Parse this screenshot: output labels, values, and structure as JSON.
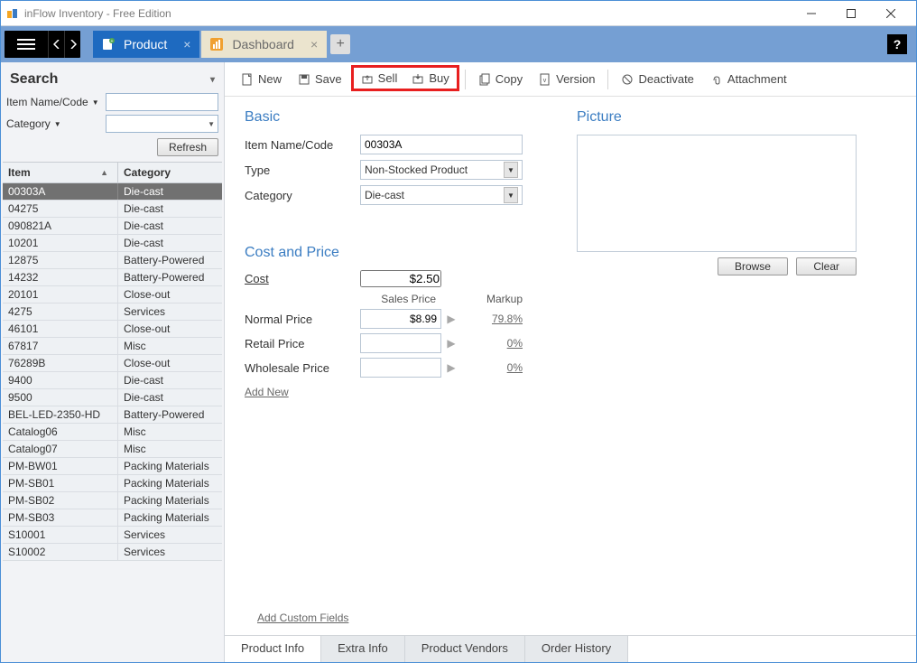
{
  "window": {
    "title": "inFlow Inventory - Free Edition"
  },
  "tabs": {
    "product": "Product",
    "dashboard": "Dashboard"
  },
  "toolbar": {
    "new": "New",
    "save": "Save",
    "sell": "Sell",
    "buy": "Buy",
    "copy": "Copy",
    "version": "Version",
    "deactivate": "Deactivate",
    "attachment": "Attachment"
  },
  "search": {
    "title": "Search",
    "itemname_label": "Item Name/Code",
    "category_label": "Category",
    "refresh": "Refresh"
  },
  "listhead": {
    "item": "Item",
    "category": "Category"
  },
  "items": [
    {
      "code": "00303A",
      "cat": "Die-cast"
    },
    {
      "code": "04275",
      "cat": "Die-cast"
    },
    {
      "code": "090821A",
      "cat": "Die-cast"
    },
    {
      "code": "10201",
      "cat": "Die-cast"
    },
    {
      "code": "12875",
      "cat": "Battery-Powered"
    },
    {
      "code": "14232",
      "cat": "Battery-Powered"
    },
    {
      "code": "20101",
      "cat": "Close-out"
    },
    {
      "code": "4275",
      "cat": "Services"
    },
    {
      "code": "46101",
      "cat": "Close-out"
    },
    {
      "code": "67817",
      "cat": "Misc"
    },
    {
      "code": "76289B",
      "cat": "Close-out"
    },
    {
      "code": "9400",
      "cat": "Die-cast"
    },
    {
      "code": "9500",
      "cat": "Die-cast"
    },
    {
      "code": "BEL-LED-2350-HD",
      "cat": "Battery-Powered"
    },
    {
      "code": "Catalog06",
      "cat": "Misc"
    },
    {
      "code": "Catalog07",
      "cat": "Misc"
    },
    {
      "code": "PM-BW01",
      "cat": "Packing Materials"
    },
    {
      "code": "PM-SB01",
      "cat": "Packing Materials"
    },
    {
      "code": "PM-SB02",
      "cat": "Packing Materials"
    },
    {
      "code": "PM-SB03",
      "cat": "Packing Materials"
    },
    {
      "code": "S10001",
      "cat": "Services"
    },
    {
      "code": "S10002",
      "cat": "Services"
    }
  ],
  "basic": {
    "title": "Basic",
    "itemname_label": "Item Name/Code",
    "itemname_value": "00303A",
    "type_label": "Type",
    "type_value": "Non-Stocked Product",
    "category_label": "Category",
    "category_value": "Die-cast"
  },
  "picture": {
    "title": "Picture",
    "browse": "Browse",
    "clear": "Clear"
  },
  "cost": {
    "title": "Cost and Price",
    "cost_label": "Cost",
    "cost_value": "$2.50",
    "sales_price_h": "Sales Price",
    "markup_h": "Markup",
    "normal_label": "Normal Price",
    "normal_value": "$8.99",
    "normal_markup": "79.8%",
    "retail_label": "Retail Price",
    "retail_value": "",
    "retail_markup": "0%",
    "wholesale_label": "Wholesale Price",
    "wholesale_value": "",
    "wholesale_markup": "0%",
    "add_new": "Add New",
    "add_custom": "Add Custom Fields"
  },
  "bottomtabs": {
    "product_info": "Product Info",
    "extra_info": "Extra Info",
    "vendors": "Product Vendors",
    "order_history": "Order History"
  }
}
